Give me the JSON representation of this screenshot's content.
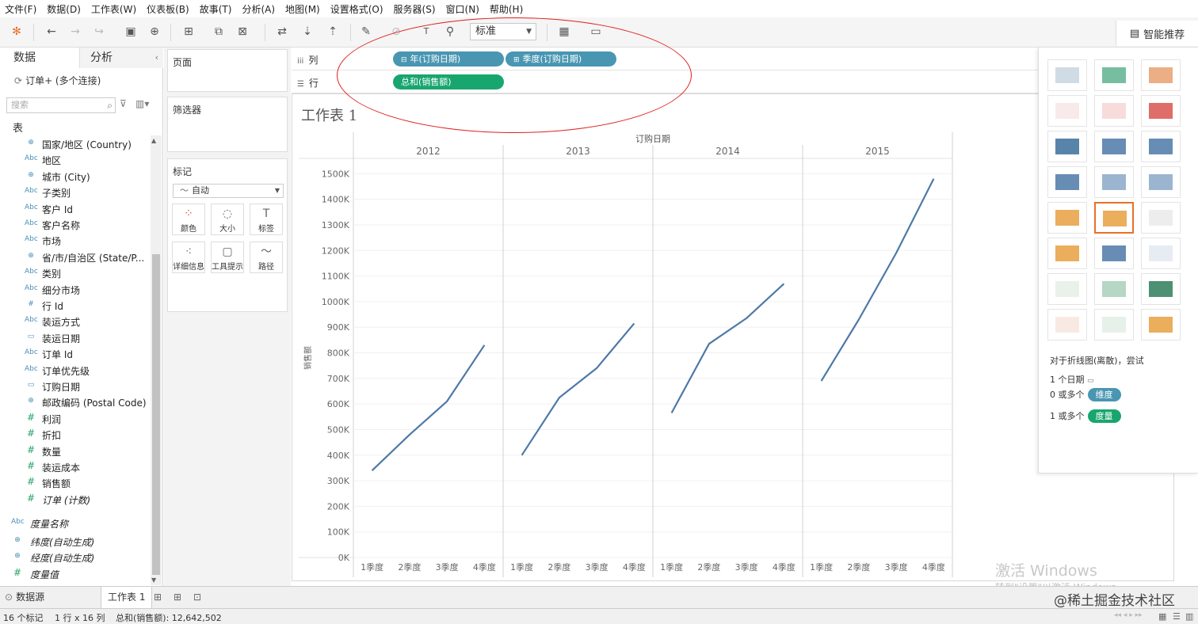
{
  "menu": [
    "文件(F)",
    "数据(D)",
    "工作表(W)",
    "仪表板(B)",
    "故事(T)",
    "分析(A)",
    "地图(M)",
    "设置格式(O)",
    "服务器(S)",
    "窗口(N)",
    "帮助(H)"
  ],
  "toolbar": {
    "view_size": "标准",
    "smart_button": "智能推荐"
  },
  "left": {
    "tab_data": "数据",
    "tab_analysis": "分析",
    "connection": "订单+ (多个连接)",
    "search_placeholder": "搜索",
    "section_table": "表",
    "fields": [
      {
        "type": "geo",
        "label": "国家/地区 (Country)"
      },
      {
        "type": "abc",
        "label": "地区"
      },
      {
        "type": "geo",
        "label": "城市 (City)"
      },
      {
        "type": "abc",
        "label": "子类别"
      },
      {
        "type": "abc",
        "label": "客户 Id"
      },
      {
        "type": "abc",
        "label": "客户名称"
      },
      {
        "type": "abc",
        "label": "市场"
      },
      {
        "type": "geo",
        "label": "省/市/自治区 (State/P..."
      },
      {
        "type": "abc",
        "label": "类别"
      },
      {
        "type": "abc",
        "label": "细分市场"
      },
      {
        "type": "num",
        "label": "行 Id"
      },
      {
        "type": "abc",
        "label": "装运方式"
      },
      {
        "type": "date",
        "label": "装运日期"
      },
      {
        "type": "abc",
        "label": "订单 Id"
      },
      {
        "type": "abc",
        "label": "订单优先级"
      },
      {
        "type": "date",
        "label": "订购日期"
      },
      {
        "type": "geo",
        "label": "邮政编码 (Postal Code)"
      },
      {
        "type": "measure",
        "label": "利润"
      },
      {
        "type": "measure",
        "label": "折扣"
      },
      {
        "type": "measure",
        "label": "数量"
      },
      {
        "type": "measure",
        "label": "装运成本"
      },
      {
        "type": "measure",
        "label": "销售额"
      },
      {
        "type": "measure",
        "label": "订单 (计数)",
        "italic": true
      }
    ],
    "extra_fields": [
      {
        "type": "abc",
        "label": "度量名称"
      },
      {
        "type": "geo",
        "label": "纬度(自动生成)"
      },
      {
        "type": "geo",
        "label": "经度(自动生成)"
      },
      {
        "type": "measure",
        "label": "度量值"
      }
    ]
  },
  "mid": {
    "pages": "页面",
    "filters": "筛选器",
    "marks": "标记",
    "mark_type": "自动",
    "mark_buttons": [
      {
        "icon": "color-icon",
        "label": "颜色"
      },
      {
        "icon": "size-icon",
        "label": "大小"
      },
      {
        "icon": "label-icon",
        "label": "标签"
      },
      {
        "icon": "detail-icon",
        "label": "详细信息"
      },
      {
        "icon": "tooltip-icon",
        "label": "工具提示"
      },
      {
        "icon": "path-icon",
        "label": "路径"
      }
    ]
  },
  "shelves": {
    "columns_label": "列",
    "rows_label": "行",
    "col_pills": [
      "年(订购日期)",
      "季度(订购日期)"
    ],
    "row_pills": [
      "总和(销售额)"
    ]
  },
  "view": {
    "sheet_title": "工作表 1"
  },
  "chart_data": {
    "type": "line",
    "title": "工作表 1",
    "header": "订购日期",
    "ylabel": "销售额",
    "panes": [
      "2012",
      "2013",
      "2014",
      "2015"
    ],
    "categories": [
      "1季度",
      "2季度",
      "3季度",
      "4季度"
    ],
    "series": [
      {
        "pane": "2012",
        "values": [
          340000,
          480000,
          610000,
          830000
        ]
      },
      {
        "pane": "2013",
        "values": [
          400000,
          625000,
          740000,
          915000
        ]
      },
      {
        "pane": "2014",
        "values": [
          565000,
          835000,
          935000,
          1070000
        ]
      },
      {
        "pane": "2015",
        "values": [
          690000,
          930000,
          1190000,
          1480000
        ]
      }
    ],
    "yticks": [
      0,
      100000,
      200000,
      300000,
      400000,
      500000,
      600000,
      700000,
      800000,
      900000,
      1000000,
      1100000,
      1200000,
      1300000,
      1400000,
      1500000
    ],
    "yticklabels": [
      "0K",
      "100K",
      "200K",
      "300K",
      "400K",
      "500K",
      "600K",
      "700K",
      "800K",
      "900K",
      "1000K",
      "1100K",
      "1200K",
      "1300K",
      "1400K",
      "1500K"
    ],
    "ylim": [
      0,
      1560000
    ],
    "color": "#4e79a7",
    "grid": true
  },
  "smart": {
    "hint_title": "对于折线图(离散)，尝试",
    "hint_date": "1 个日期",
    "hint_dim_prefix": "0 或多个",
    "hint_dim": "维度",
    "hint_measure_prefix": "1 或多个",
    "hint_measure": "度量"
  },
  "bottom": {
    "datasource": "数据源",
    "sheet_tab": "工作表 1",
    "status_marks": "16 个标记",
    "status_rowscols": "1 行 x 16 列",
    "status_sum": "总和(销售额): 12,642,502"
  },
  "watermark": {
    "line1": "激活 Windows",
    "line2": "转到\"设置\"以激活 Windows。",
    "site": "@稀土掘金技术社区"
  },
  "colors": {
    "blue_pill": "#4996b2",
    "green_pill": "#18a66f",
    "selected_border": "#e8702a",
    "annotation": "#e02020"
  }
}
